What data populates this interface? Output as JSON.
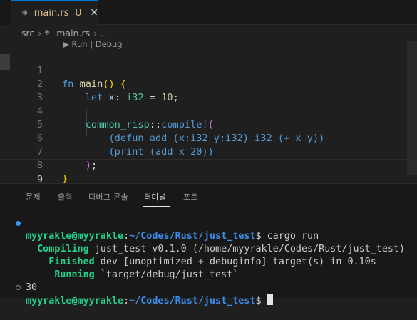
{
  "tab": {
    "icon": "rust-file-icon",
    "filename": "main.rs",
    "status": "U",
    "close": "✕"
  },
  "breadcrumb": {
    "folder": "src",
    "file": "main.rs",
    "more": "…"
  },
  "codelens": "▶ Run | Debug",
  "editor": {
    "line_numbers": [
      "1",
      "2",
      "3",
      "4",
      "5",
      "6",
      "7",
      "8",
      "9"
    ],
    "current_line": "9"
  },
  "code": {
    "l1": {
      "kw": "fn",
      "name": "main",
      "rest": "() {"
    },
    "l2": {
      "kw": "let",
      "var": "x",
      "colon": ":",
      "ty": "i32",
      "eq": " = ",
      "num": "10",
      "semi": ";"
    },
    "l4": {
      "ns": "common_risp",
      "sep": "::",
      "mac": "compile!",
      "open": "("
    },
    "l5": {
      "a": "(defun",
      "b": " add ",
      "c": "(x:i32 y:i32)",
      "d": " i32 ",
      "e": "(+ x y)",
      "f": ")"
    },
    "l6": {
      "a": "(print",
      "b": " ",
      "c": "(add x 20)",
      "d": ")"
    },
    "l7": {
      "close": ")",
      "semi": ";"
    },
    "l8": {
      "brace": "}"
    }
  },
  "panel": {
    "tabs": [
      "문제",
      "출력",
      "디버그 콘솔",
      "터미널",
      "포트"
    ],
    "active_tab": "터미널"
  },
  "terminal": {
    "prompt_user": "myyrakle@myyrakle",
    "prompt_sep": ":",
    "prompt_path": "~/Codes/Rust/just_test",
    "prompt_end": "$",
    "command": " cargo run",
    "compiling_label": "Compiling",
    "compiling_text": " just_test v0.1.0 (/home/myyrakle/Codes/Rust/just_test)",
    "finished_label": "Finished",
    "finished_text": " dev [unoptimized + debuginfo] target(s) in 0.10s",
    "running_label": "Running",
    "running_text": " `target/debug/just_test`",
    "output": "30"
  }
}
